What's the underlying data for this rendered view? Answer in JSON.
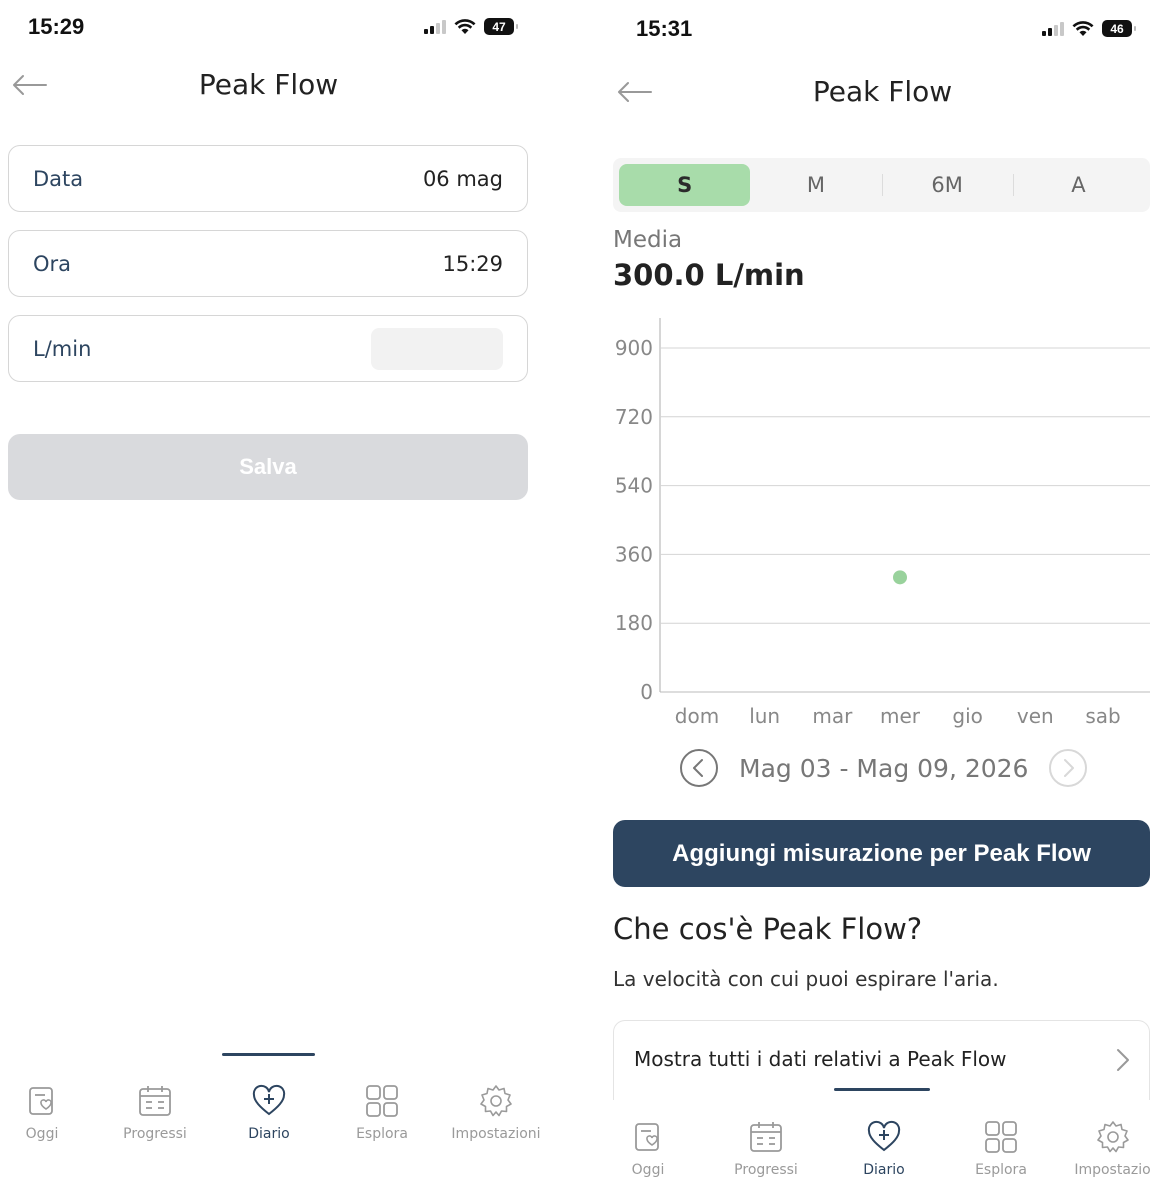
{
  "left_screen": {
    "status": {
      "time": "15:29",
      "battery": "47"
    },
    "title": "Peak Flow",
    "fields": [
      {
        "label": "Data",
        "value": "06 mag"
      },
      {
        "label": "Ora",
        "value": "15:29"
      },
      {
        "label": "L/min",
        "value": ""
      }
    ],
    "save_label": "Salva",
    "tabs": [
      {
        "label": "Oggi",
        "icon": "today-icon"
      },
      {
        "label": "Progressi",
        "icon": "calendar-icon"
      },
      {
        "label": "Diario",
        "icon": "heart-plus-icon"
      },
      {
        "label": "Esplora",
        "icon": "grid-icon"
      },
      {
        "label": "Impostazioni",
        "icon": "gear-icon"
      }
    ],
    "active_tab": 2
  },
  "right_screen": {
    "status": {
      "time": "15:31",
      "battery": "46"
    },
    "title": "Peak Flow",
    "segments": [
      {
        "label": "S",
        "active": true
      },
      {
        "label": "M",
        "active": false
      },
      {
        "label": "6M",
        "active": false
      },
      {
        "label": "A",
        "active": false
      }
    ],
    "average_label": "Media",
    "average_value": "300.0 L/min",
    "week_range": "Mag 03 - Mag 09, 2026",
    "add_button_label": "Aggiungi misurazione per Peak Flow",
    "info_title": "Che cos'è Peak Flow?",
    "info_description": "La velocità con cui puoi espirare l'aria.",
    "show_all_label": "Mostra tutti i dati relativi a Peak Flow",
    "tabs": [
      {
        "label": "Oggi",
        "icon": "today-icon"
      },
      {
        "label": "Progressi",
        "icon": "calendar-icon"
      },
      {
        "label": "Diario",
        "icon": "heart-plus-icon"
      },
      {
        "label": "Esplora",
        "icon": "grid-icon"
      },
      {
        "label": "Impostazio",
        "icon": "gear-icon"
      }
    ],
    "active_tab": 2
  },
  "colors": {
    "accent_navy": "#2d4560",
    "segment_active": "#a8dcaa",
    "data_point": "#99d29c",
    "disabled_button": "#d9dadd"
  },
  "chart_data": {
    "type": "scatter",
    "categories": [
      "dom",
      "lun",
      "mar",
      "mer",
      "gio",
      "ven",
      "sab"
    ],
    "yticks": [
      0,
      180,
      360,
      540,
      720,
      900
    ],
    "ylim": [
      0,
      900
    ],
    "points": [
      {
        "category": "mer",
        "y": 300
      }
    ],
    "grid": true
  }
}
